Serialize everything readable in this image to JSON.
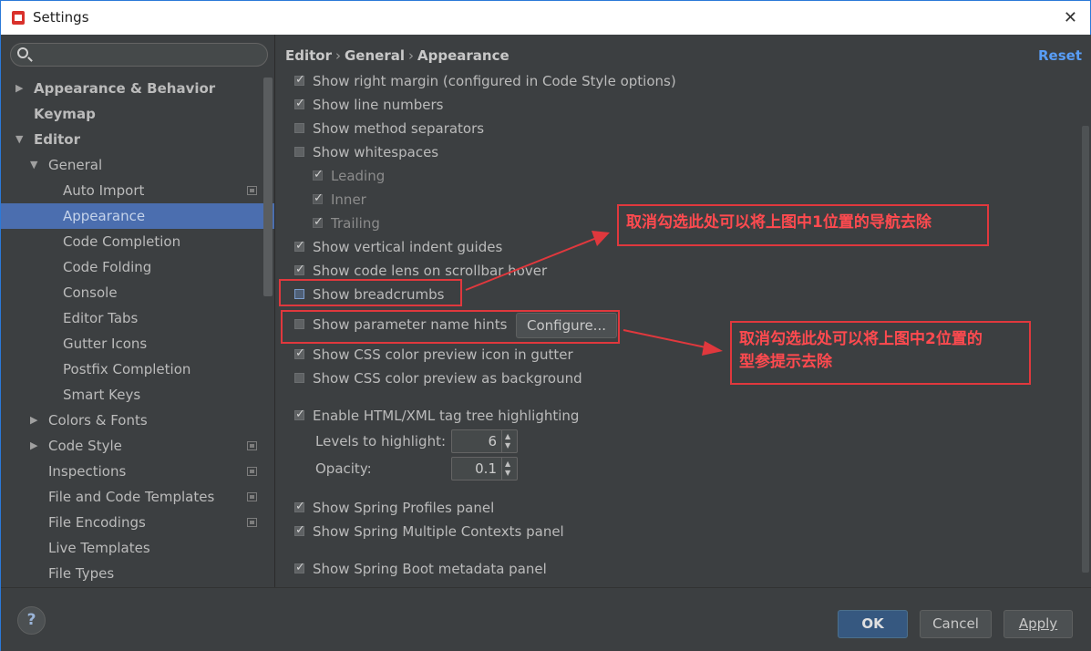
{
  "window": {
    "title": "Settings"
  },
  "search": {
    "placeholder": ""
  },
  "sidebar": {
    "items": [
      {
        "label": "Appearance & Behavior",
        "arrow": "▶",
        "indent": 0,
        "bold": true,
        "selected": false,
        "project_icon": false
      },
      {
        "label": "Keymap",
        "arrow": "",
        "indent": 0,
        "bold": true,
        "selected": false,
        "project_icon": false
      },
      {
        "label": "Editor",
        "arrow": "▼",
        "indent": 0,
        "bold": true,
        "selected": false,
        "project_icon": false
      },
      {
        "label": "General",
        "arrow": "▼",
        "indent": 1,
        "bold": false,
        "selected": false,
        "project_icon": false
      },
      {
        "label": "Auto Import",
        "arrow": "",
        "indent": 2,
        "bold": false,
        "selected": false,
        "project_icon": true
      },
      {
        "label": "Appearance",
        "arrow": "",
        "indent": 2,
        "bold": false,
        "selected": true,
        "project_icon": false
      },
      {
        "label": "Code Completion",
        "arrow": "",
        "indent": 2,
        "bold": false,
        "selected": false,
        "project_icon": false
      },
      {
        "label": "Code Folding",
        "arrow": "",
        "indent": 2,
        "bold": false,
        "selected": false,
        "project_icon": false
      },
      {
        "label": "Console",
        "arrow": "",
        "indent": 2,
        "bold": false,
        "selected": false,
        "project_icon": false
      },
      {
        "label": "Editor Tabs",
        "arrow": "",
        "indent": 2,
        "bold": false,
        "selected": false,
        "project_icon": false
      },
      {
        "label": "Gutter Icons",
        "arrow": "",
        "indent": 2,
        "bold": false,
        "selected": false,
        "project_icon": false
      },
      {
        "label": "Postfix Completion",
        "arrow": "",
        "indent": 2,
        "bold": false,
        "selected": false,
        "project_icon": false
      },
      {
        "label": "Smart Keys",
        "arrow": "",
        "indent": 2,
        "bold": false,
        "selected": false,
        "project_icon": false
      },
      {
        "label": "Colors & Fonts",
        "arrow": "▶",
        "indent": 1,
        "bold": false,
        "selected": false,
        "project_icon": false
      },
      {
        "label": "Code Style",
        "arrow": "▶",
        "indent": 1,
        "bold": false,
        "selected": false,
        "project_icon": true
      },
      {
        "label": "Inspections",
        "arrow": "",
        "indent": 1,
        "bold": false,
        "selected": false,
        "project_icon": true
      },
      {
        "label": "File and Code Templates",
        "arrow": "",
        "indent": 1,
        "bold": false,
        "selected": false,
        "project_icon": true
      },
      {
        "label": "File Encodings",
        "arrow": "",
        "indent": 1,
        "bold": false,
        "selected": false,
        "project_icon": true
      },
      {
        "label": "Live Templates",
        "arrow": "",
        "indent": 1,
        "bold": false,
        "selected": false,
        "project_icon": false
      },
      {
        "label": "File Types",
        "arrow": "",
        "indent": 1,
        "bold": false,
        "selected": false,
        "project_icon": false
      }
    ]
  },
  "breadcrumb": {
    "parts": [
      "Editor",
      "General",
      "Appearance"
    ]
  },
  "main": {
    "reset_label": "Reset",
    "options": {
      "right_margin": {
        "label": "Show right margin (configured in Code Style options)",
        "checked": true
      },
      "line_numbers": {
        "label": "Show line numbers",
        "checked": true
      },
      "method_separators": {
        "label": "Show method separators",
        "checked": false
      },
      "whitespaces": {
        "label": "Show whitespaces",
        "checked": false
      },
      "leading": {
        "label": "Leading",
        "checked": true
      },
      "inner": {
        "label": "Inner",
        "checked": true
      },
      "trailing": {
        "label": "Trailing",
        "checked": true
      },
      "indent_guides": {
        "label": "Show vertical indent guides",
        "checked": true
      },
      "code_lens": {
        "label": "Show code lens on scrollbar hover",
        "checked": true
      },
      "breadcrumbs": {
        "label": "Show breadcrumbs",
        "checked": false
      },
      "param_hints": {
        "label": "Show parameter name hints",
        "checked": false
      },
      "css_icon": {
        "label": "Show CSS color preview icon in gutter",
        "checked": true
      },
      "css_bg": {
        "label": "Show CSS color preview as background",
        "checked": false
      },
      "html_tree": {
        "label": "Enable HTML/XML tag tree highlighting",
        "checked": true
      },
      "spring_profiles": {
        "label": "Show Spring Profiles panel",
        "checked": true
      },
      "spring_contexts": {
        "label": "Show Spring Multiple Contexts panel",
        "checked": true
      },
      "spring_boot": {
        "label": "Show Spring Boot metadata panel",
        "checked": true
      }
    },
    "configure_label": "Configure...",
    "levels": {
      "label": "Levels to highlight:",
      "value": "6"
    },
    "opacity": {
      "label": "Opacity:",
      "value": "0.1"
    }
  },
  "annotations": {
    "note1": "取消勾选此处可以将上图中1位置的导航去除",
    "note2_line1": "取消勾选此处可以将上图中2位置的",
    "note2_line2": "型参提示去除"
  },
  "footer": {
    "help_label": "?",
    "ok_label": "OK",
    "cancel_label": "Cancel",
    "apply_label": "Apply"
  }
}
